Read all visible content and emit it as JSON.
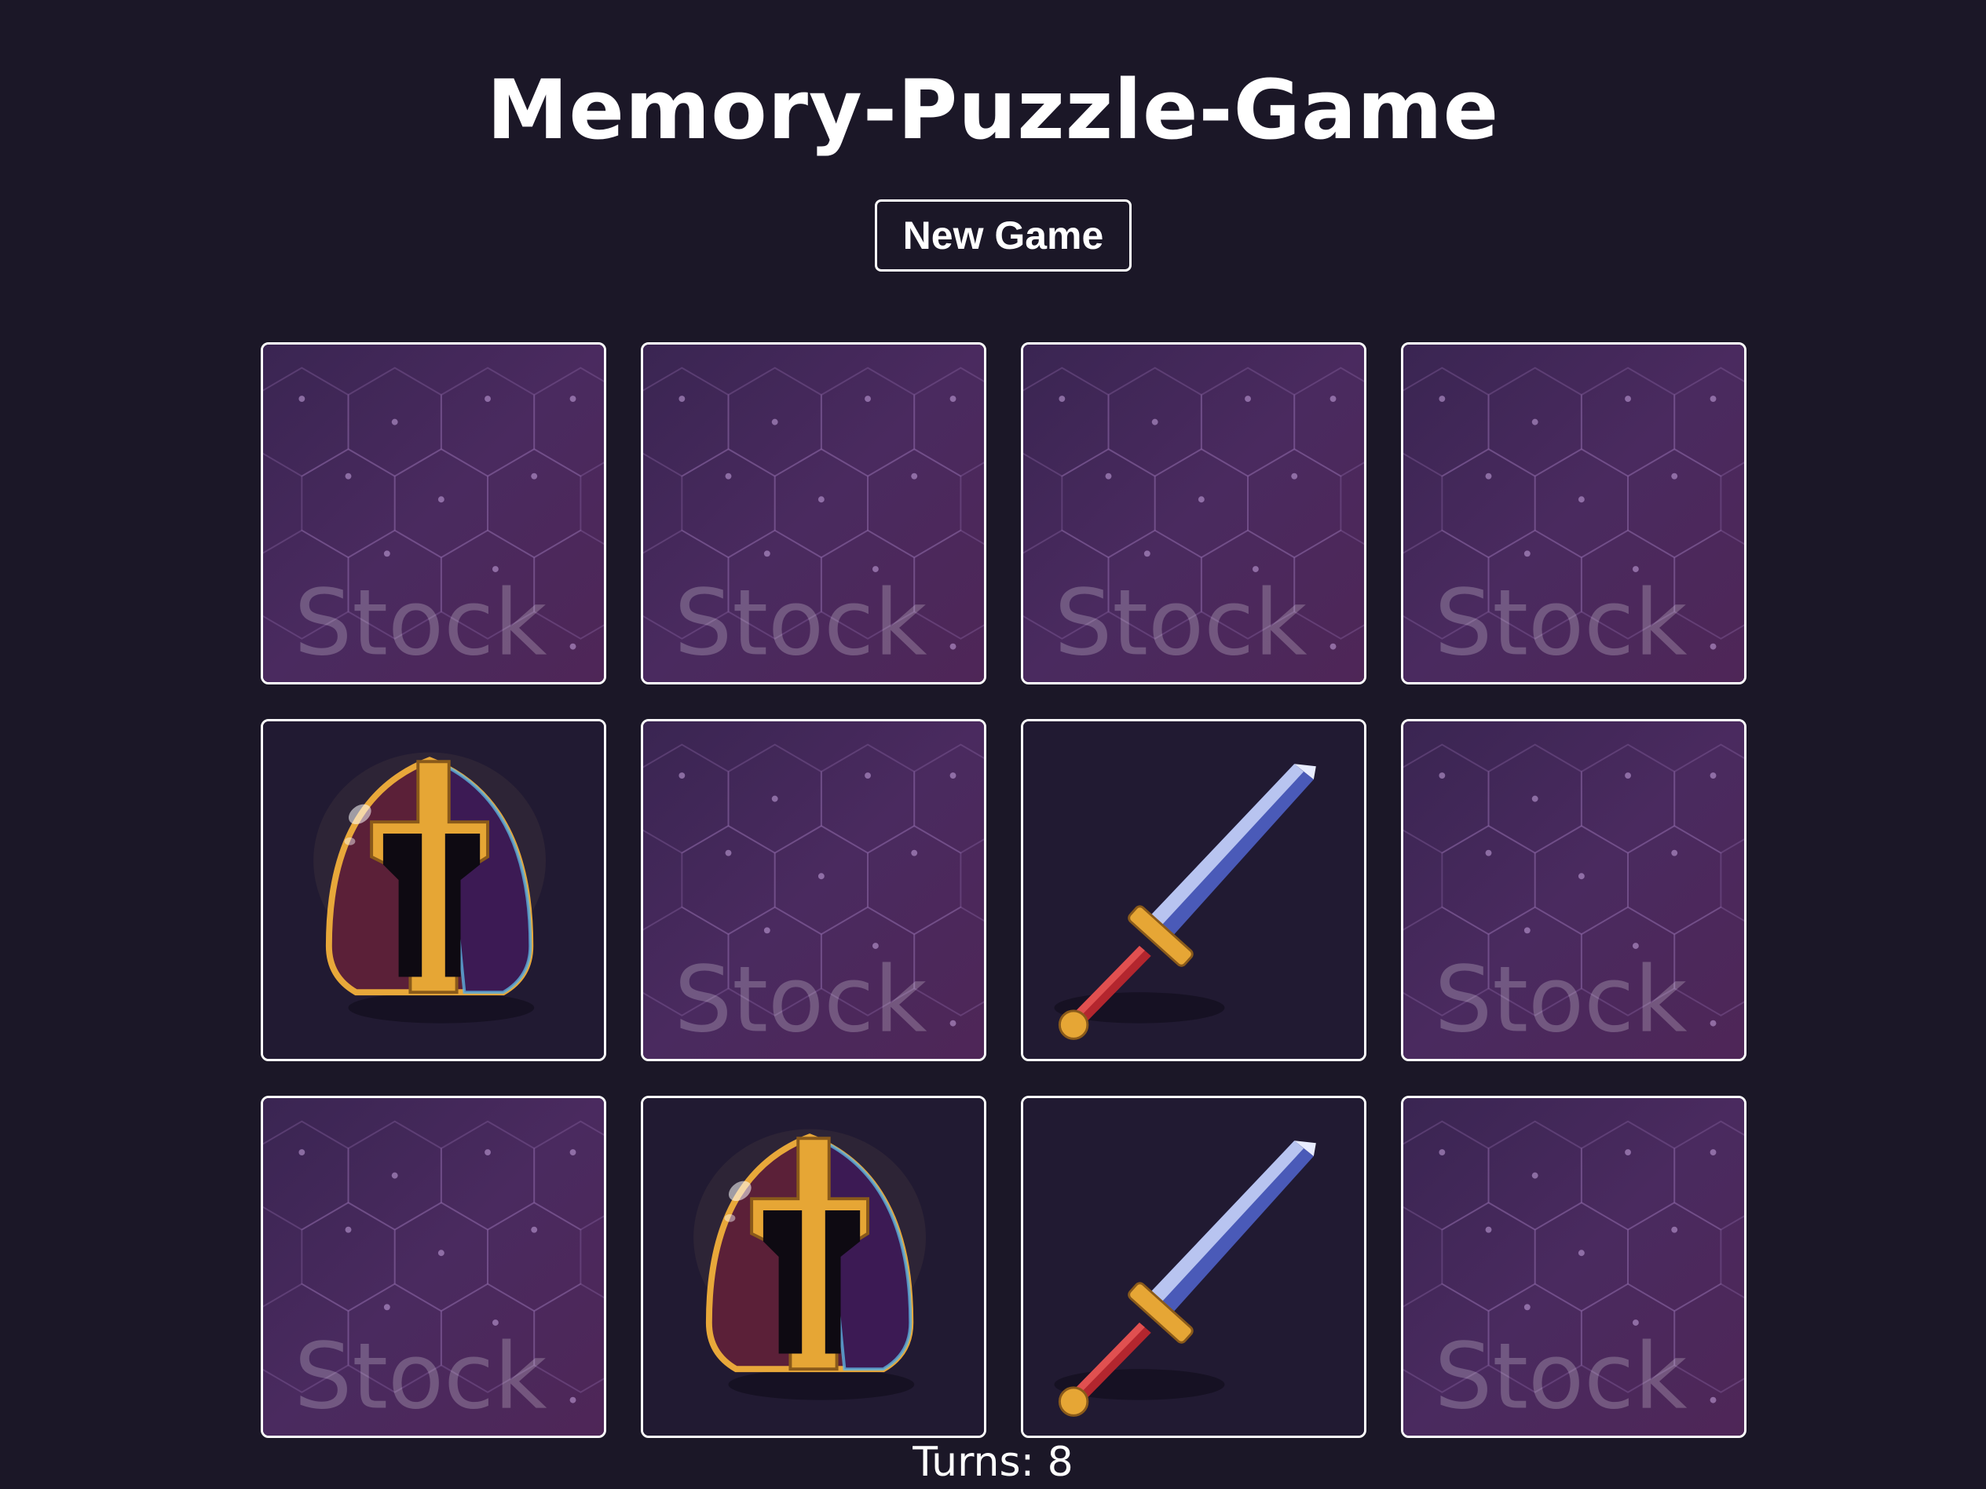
{
  "header": {
    "title": "Memory-Puzzle-Game"
  },
  "controls": {
    "new_game_label": "New Game"
  },
  "board": {
    "cards": [
      {
        "state": "hidden",
        "face": "card-back-icon"
      },
      {
        "state": "hidden",
        "face": "card-back-icon"
      },
      {
        "state": "hidden",
        "face": "card-back-icon"
      },
      {
        "state": "hidden",
        "face": "card-back-icon"
      },
      {
        "state": "revealed",
        "face": "helmet-icon"
      },
      {
        "state": "hidden",
        "face": "card-back-icon"
      },
      {
        "state": "revealed",
        "face": "sword-icon"
      },
      {
        "state": "hidden",
        "face": "card-back-icon"
      },
      {
        "state": "hidden",
        "face": "card-back-icon"
      },
      {
        "state": "revealed",
        "face": "helmet-icon"
      },
      {
        "state": "revealed",
        "face": "sword-icon"
      },
      {
        "state": "hidden",
        "face": "card-back-icon"
      }
    ],
    "watermark": "Stock"
  },
  "status": {
    "turns_text": "Turns: 8"
  },
  "colors": {
    "background": "#1b1727",
    "card_back": "#4a2a5c",
    "card_face": "#211a32",
    "border": "#ffffff"
  }
}
